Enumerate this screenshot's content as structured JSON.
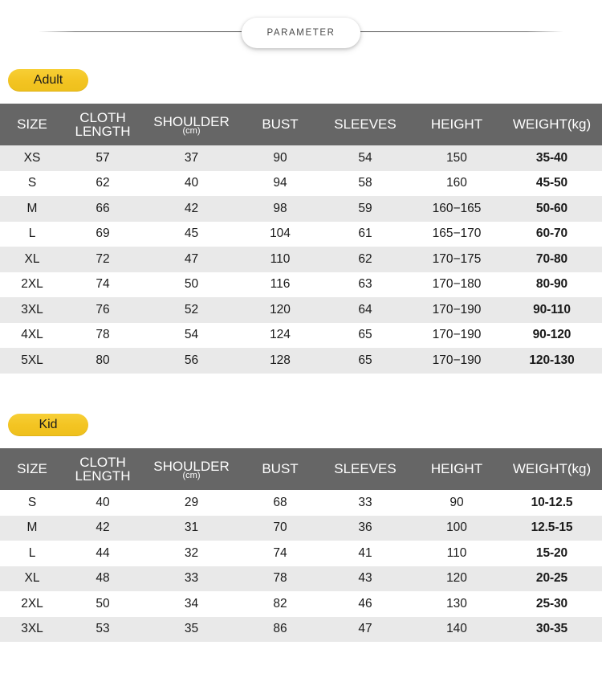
{
  "banner": {
    "title": "PARAMETER"
  },
  "sections": [
    {
      "badge": "Adult",
      "columns": [
        {
          "label": "SIZE",
          "sub": ""
        },
        {
          "label": "CLOTH LENGTH",
          "line1": "CLOTH",
          "line2": "LENGTH",
          "sub": ""
        },
        {
          "label": "SHOULDER",
          "sub": "(cm)"
        },
        {
          "label": "BUST",
          "sub": ""
        },
        {
          "label": "SLEEVES",
          "sub": ""
        },
        {
          "label": "HEIGHT",
          "sub": ""
        },
        {
          "label": "WEIGHT(kg)",
          "sub": ""
        }
      ],
      "rows": [
        {
          "size": "XS",
          "cloth_length": "57",
          "shoulder": "37",
          "bust": "90",
          "sleeves": "54",
          "height": "150",
          "weight": "35-40"
        },
        {
          "size": "S",
          "cloth_length": "62",
          "shoulder": "40",
          "bust": "94",
          "sleeves": "58",
          "height": "160",
          "weight": "45-50"
        },
        {
          "size": "M",
          "cloth_length": "66",
          "shoulder": "42",
          "bust": "98",
          "sleeves": "59",
          "height": "160−165",
          "weight": "50-60"
        },
        {
          "size": "L",
          "cloth_length": "69",
          "shoulder": "45",
          "bust": "104",
          "sleeves": "61",
          "height": "165−170",
          "weight": "60-70"
        },
        {
          "size": "XL",
          "cloth_length": "72",
          "shoulder": "47",
          "bust": "110",
          "sleeves": "62",
          "height": "170−175",
          "weight": "70-80"
        },
        {
          "size": "2XL",
          "cloth_length": "74",
          "shoulder": "50",
          "bust": "116",
          "sleeves": "63",
          "height": "170−180",
          "weight": "80-90"
        },
        {
          "size": "3XL",
          "cloth_length": "76",
          "shoulder": "52",
          "bust": "120",
          "sleeves": "64",
          "height": "170−190",
          "weight": "90-110"
        },
        {
          "size": "4XL",
          "cloth_length": "78",
          "shoulder": "54",
          "bust": "124",
          "sleeves": "65",
          "height": "170−190",
          "weight": "90-120"
        },
        {
          "size": "5XL",
          "cloth_length": "80",
          "shoulder": "56",
          "bust": "128",
          "sleeves": "65",
          "height": "170−190",
          "weight": "120-130"
        }
      ]
    },
    {
      "badge": "Kid",
      "columns": [
        {
          "label": "SIZE",
          "sub": ""
        },
        {
          "label": "CLOTH LENGTH",
          "line1": "CLOTH",
          "line2": "LENGTH",
          "sub": ""
        },
        {
          "label": "SHOULDER",
          "sub": "(cm)"
        },
        {
          "label": "BUST",
          "sub": ""
        },
        {
          "label": "SLEEVES",
          "sub": ""
        },
        {
          "label": "HEIGHT",
          "sub": ""
        },
        {
          "label": "WEIGHT(kg)",
          "sub": ""
        }
      ],
      "rows": [
        {
          "size": "S",
          "cloth_length": "40",
          "shoulder": "29",
          "bust": "68",
          "sleeves": "33",
          "height": "90",
          "weight": "10-12.5"
        },
        {
          "size": "M",
          "cloth_length": "42",
          "shoulder": "31",
          "bust": "70",
          "sleeves": "36",
          "height": "100",
          "weight": "12.5-15"
        },
        {
          "size": "L",
          "cloth_length": "44",
          "shoulder": "32",
          "bust": "74",
          "sleeves": "41",
          "height": "110",
          "weight": "15-20"
        },
        {
          "size": "XL",
          "cloth_length": "48",
          "shoulder": "33",
          "bust": "78",
          "sleeves": "43",
          "height": "120",
          "weight": "20-25"
        },
        {
          "size": "2XL",
          "cloth_length": "50",
          "shoulder": "34",
          "bust": "82",
          "sleeves": "46",
          "height": "130",
          "weight": "25-30"
        },
        {
          "size": "3XL",
          "cloth_length": "53",
          "shoulder": "35",
          "bust": "86",
          "sleeves": "47",
          "height": "140",
          "weight": "30-35"
        }
      ]
    }
  ],
  "colors": {
    "header_gray": "#666666",
    "row_alt": "#e9e9e9",
    "row_base": "#ffffff",
    "badge_yellow": "#f3c422",
    "text_dark": "#1a1a1a"
  }
}
